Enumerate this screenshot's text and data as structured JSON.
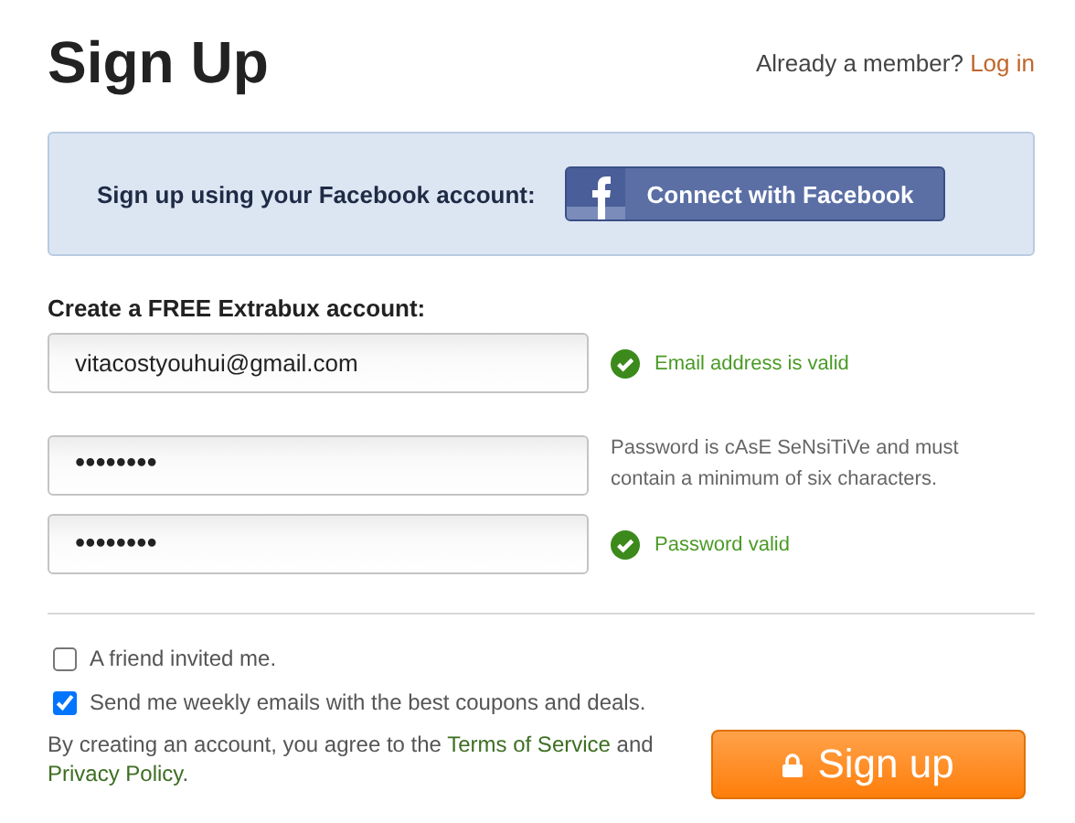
{
  "title": "Sign Up",
  "member_prompt": {
    "text": "Already a member?",
    "link": "Log in"
  },
  "facebook_banner": {
    "label": "Sign up using your Facebook account:",
    "button": "Connect with Facebook"
  },
  "form_heading": "Create a FREE Extrabux account:",
  "fields": [
    {
      "value": "vitacostyouhui@gmail.com",
      "kind": "email",
      "message": {
        "kind": "success",
        "text": "Email address is valid"
      }
    },
    {
      "value": "••••••••",
      "kind": "password",
      "message": {
        "kind": "hint",
        "text": "Password is cAsE SeNsiTiVe and must contain a minimum of six characters."
      }
    },
    {
      "value": "••••••••",
      "kind": "password",
      "message": {
        "kind": "success",
        "text": "Password valid"
      }
    }
  ],
  "checkboxes": [
    {
      "label": "A friend invited me.",
      "checked": false
    },
    {
      "label": "Send me weekly emails with the best coupons and deals.",
      "checked": true
    }
  ],
  "terms": {
    "before": "By creating an account, you agree to the ",
    "terms_link": "Terms of Service",
    "middle": " and ",
    "privacy_link": "Privacy Policy",
    "end": "."
  },
  "submit_button": "Sign up"
}
